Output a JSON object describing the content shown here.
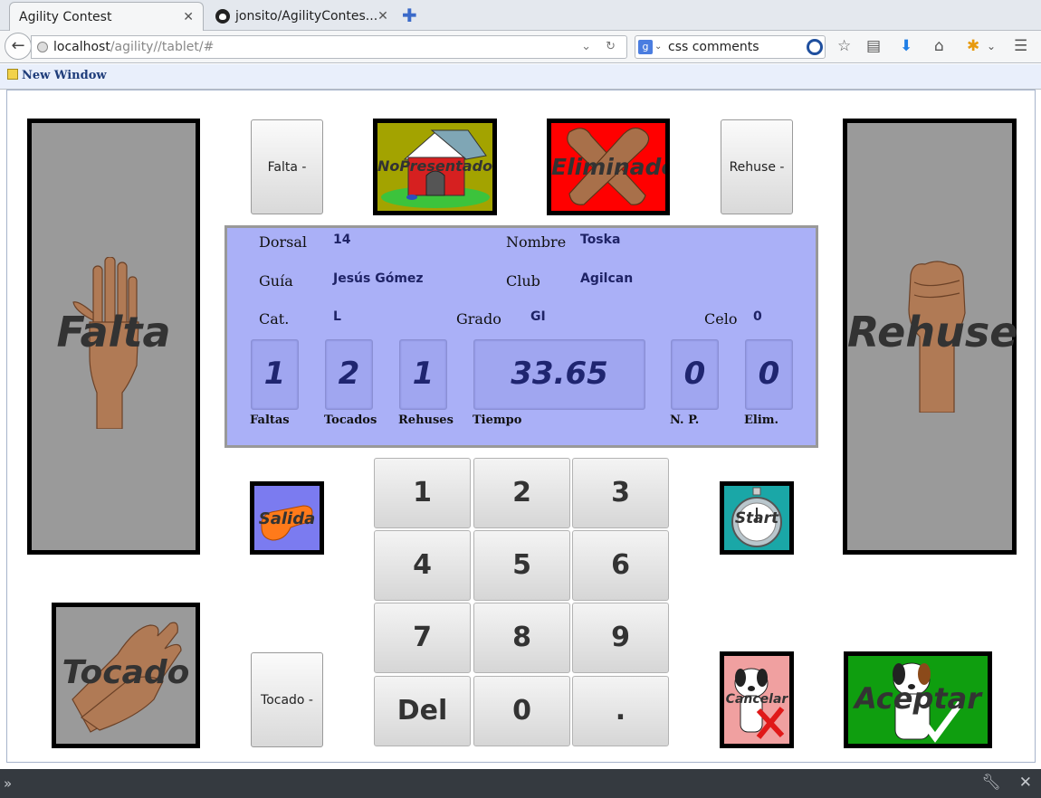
{
  "browser": {
    "tabs": [
      {
        "title": "Agility Contest"
      },
      {
        "title": "jonsito/AgilityContes..."
      }
    ],
    "url_host": "localhost",
    "url_path": "/agility//tablet/#",
    "search_value": "css comments",
    "bookmark": "New Window"
  },
  "app": {
    "falta_panel": "Falta",
    "rehuse_panel": "Rehuse",
    "tocado_panel": "Tocado",
    "falta_minus": "Falta -",
    "rehuse_minus": "Rehuse -",
    "tocado_minus": "Tocado -",
    "no_presentado": "NoPresentado",
    "eliminado": "Eliminado",
    "salida": "Salida",
    "start": "Start",
    "cancelar": "Cancelar",
    "aceptar": "Aceptar"
  },
  "info": {
    "dorsal_label": "Dorsal",
    "dorsal": "14",
    "nombre_label": "Nombre",
    "nombre": "Toska",
    "guia_label": "Guía",
    "guia": "Jesús Gómez",
    "club_label": "Club",
    "club": "Agilcan",
    "cat_label": "Cat.",
    "cat": "L",
    "grado_label": "Grado",
    "grado": "GI",
    "celo_label": "Celo",
    "celo": "0",
    "faltas": "1",
    "faltas_label": "Faltas",
    "tocados": "2",
    "tocados_label": "Tocados",
    "rehuses": "1",
    "rehuses_label": "Rehuses",
    "tiempo": "33.65",
    "tiempo_label": "Tiempo",
    "np": "0",
    "np_label": "N. P.",
    "elim": "0",
    "elim_label": "Elim."
  },
  "keypad": [
    "1",
    "2",
    "3",
    "4",
    "5",
    "6",
    "7",
    "8",
    "9",
    "Del",
    "0",
    "."
  ],
  "colors": {
    "info_bg": "#aab0f7",
    "eliminado_bg": "#ff0000",
    "no_presentado_bg": "#a3a300",
    "salida_bg": "#7b7bf0",
    "start_bg": "#1aa7a7",
    "cancelar_bg": "#f0a0a0",
    "aceptar_bg": "#0f9e0f"
  }
}
